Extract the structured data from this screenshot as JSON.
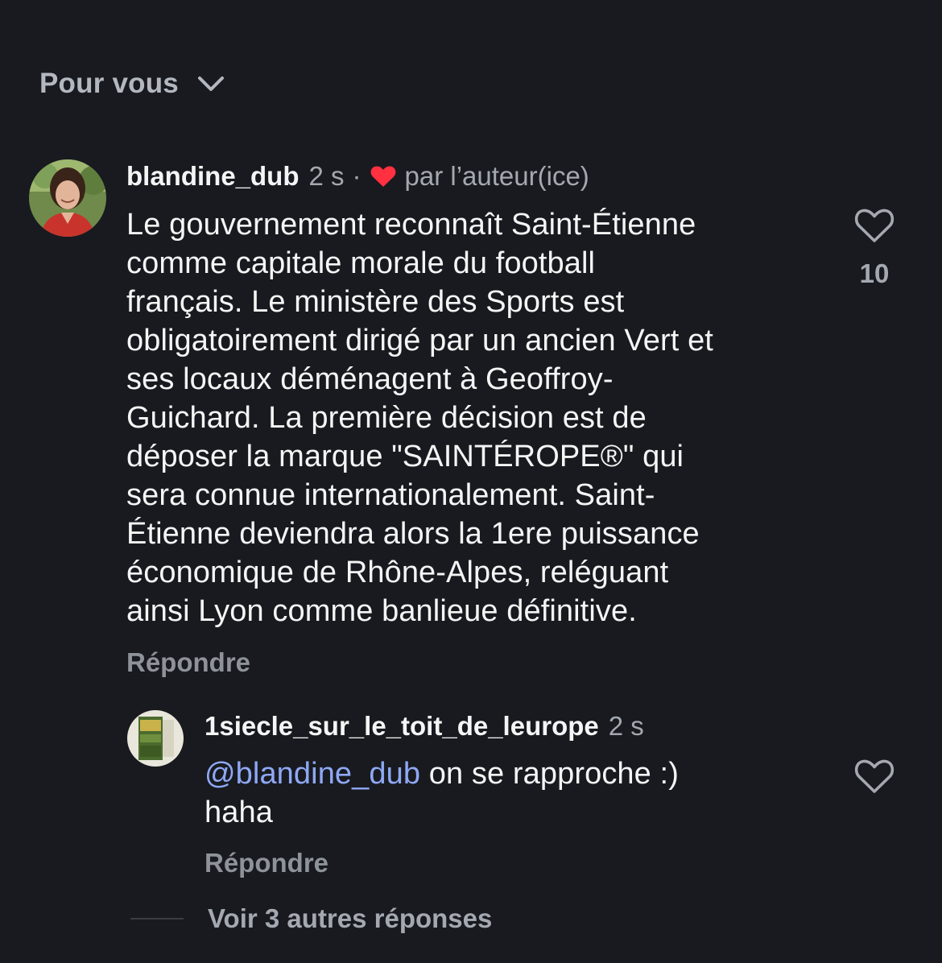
{
  "header": {
    "sort_label": "Pour vous",
    "chevron_icon": "chevron-down-icon"
  },
  "comment": {
    "username": "blandine_dub",
    "time": "2 s",
    "separator": "·",
    "liked_by_author_label": "par l’auteur(ice)",
    "text_lines": [
      "Le gouvernement reconnaît Saint-Étienne",
      "comme capitale morale du football",
      "français. Le ministère des Sports est",
      "obligatoirement dirigé par un ancien Vert et",
      "ses locaux déménagent à Geoffroy-",
      "Guichard. La première décision est de",
      "déposer la marque \"SAINTÉROPE®\" qui",
      "sera connue internationalement. Saint-",
      "Étienne deviendra alors la 1ere puissance",
      "économique de Rhône-Alpes, reléguant",
      "ainsi Lyon comme banlieue définitive."
    ],
    "reply_label": "Répondre",
    "like_count": "10",
    "like_icon": "heart-outline-icon",
    "author_heart_color": "#ff3040"
  },
  "reply": {
    "username": "1siecle_sur_le_toit_de_leurope",
    "time": "2 s",
    "mention": "@blandine_dub",
    "text_rest": " on se rapproche :)",
    "text_line2": "haha",
    "reply_label": "Répondre",
    "like_icon": "heart-outline-icon"
  },
  "more_replies_label": "Voir 3 autres réponses",
  "colors": {
    "background": "#181a1f",
    "mention": "#8fa8f5",
    "muted": "#a4a8b0"
  }
}
